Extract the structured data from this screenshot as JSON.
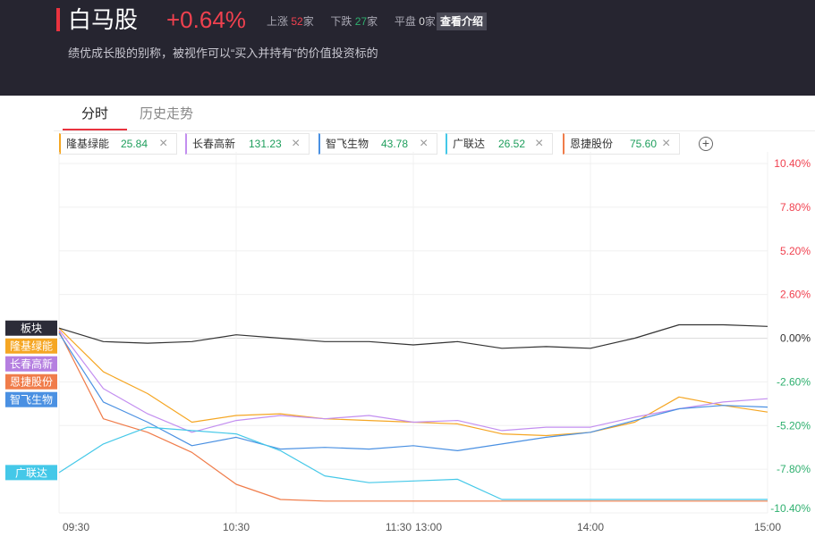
{
  "header": {
    "title": "白马股",
    "change": "+0.64%",
    "up_label": "上涨",
    "up_count": "52",
    "up_unit": "家",
    "down_label": "下跌",
    "down_count": "27",
    "down_unit": "家",
    "flat_label": "平盘",
    "flat_count": "0",
    "flat_unit": "家",
    "intro_button": "查看介绍",
    "description": "绩优成长股的别称，被视作可以“买入并持有”的价值投资标的"
  },
  "tabs": [
    {
      "label": "分时",
      "active": true
    },
    {
      "label": "历史走势",
      "active": false
    }
  ],
  "compare_chips": [
    {
      "name": "隆基绿能",
      "price": "25.84",
      "color": "#f5a623"
    },
    {
      "name": "长春高新",
      "price": "131.23",
      "color": "#c38ff0"
    },
    {
      "name": "智飞生物",
      "price": "43.78",
      "color": "#4a90e2"
    },
    {
      "name": "广联达",
      "price": "26.52",
      "color": "#44c8e8"
    },
    {
      "name": "恩捷股份",
      "price": "75.60",
      "color": "#f07c4a"
    }
  ],
  "colors": {
    "up": "#f0414f",
    "down": "#2fb06f",
    "header_bg": "#262530",
    "sector_line": "#333333"
  },
  "chart_data": {
    "type": "line",
    "x_ticks": [
      "09:30",
      "10:30",
      "11:30",
      "13:00",
      "14:00",
      "15:00"
    ],
    "y_ticks": [
      "10.40%",
      "7.80%",
      "5.20%",
      "2.60%",
      "0.00%",
      "-2.60%",
      "-5.20%",
      "-7.80%",
      "-10.40%"
    ],
    "ylim": [
      -10.4,
      10.4
    ],
    "grid": true,
    "x": [
      "09:30",
      "09:45",
      "10:00",
      "10:15",
      "10:30",
      "10:45",
      "11:00",
      "11:15",
      "11:30",
      "13:15",
      "13:30",
      "13:45",
      "14:00",
      "14:15",
      "14:30",
      "14:45",
      "15:00"
    ],
    "series": [
      {
        "name": "板块",
        "color": "#333333",
        "tag_bg": "#2c2c38",
        "values": [
          0.6,
          -0.2,
          -0.3,
          -0.2,
          0.2,
          0.0,
          -0.2,
          -0.2,
          -0.4,
          -0.2,
          -0.6,
          -0.5,
          -0.6,
          0.0,
          0.8,
          0.8,
          0.7
        ]
      },
      {
        "name": "隆基绿能",
        "color": "#f5a623",
        "tag_bg": "#f5a623",
        "values": [
          0.6,
          -2.0,
          -3.3,
          -5.0,
          -4.6,
          -4.5,
          -4.8,
          -4.9,
          -5.0,
          -5.1,
          -5.7,
          -5.8,
          -5.6,
          -5.0,
          -3.5,
          -4.0,
          -4.4
        ]
      },
      {
        "name": "长春高新",
        "color": "#c38ff0",
        "tag_bg": "#b57fe0",
        "values": [
          0.5,
          -3.0,
          -4.5,
          -5.6,
          -4.9,
          -4.6,
          -4.8,
          -4.6,
          -5.0,
          -4.9,
          -5.5,
          -5.3,
          -5.3,
          -4.7,
          -4.2,
          -3.8,
          -3.6
        ]
      },
      {
        "name": "恩捷股份",
        "color": "#f07c4a",
        "tag_bg": "#f07c4a",
        "values": [
          0.4,
          -4.8,
          -5.6,
          -6.8,
          -8.7,
          -9.6,
          -9.7,
          -9.7,
          -9.7,
          -9.7,
          -9.7,
          -9.7,
          -9.7,
          -9.7,
          -9.7,
          -9.7,
          -9.7
        ]
      },
      {
        "name": "智飞生物",
        "color": "#4a90e2",
        "tag_bg": "#4a90e2",
        "values": [
          0.3,
          -3.8,
          -5.0,
          -6.4,
          -5.9,
          -6.6,
          -6.5,
          -6.6,
          -6.4,
          -6.7,
          -6.3,
          -5.9,
          -5.6,
          -4.9,
          -4.2,
          -4.0,
          -4.1
        ]
      },
      {
        "name": "广联达",
        "color": "#44c8e8",
        "tag_bg": "#44c8e8",
        "values": [
          -8.0,
          -6.3,
          -5.3,
          -5.5,
          -5.7,
          -6.7,
          -8.2,
          -8.6,
          -8.5,
          -8.4,
          -9.6,
          -9.6,
          -9.6,
          -9.6,
          -9.6,
          -9.6,
          -9.6
        ]
      }
    ]
  }
}
